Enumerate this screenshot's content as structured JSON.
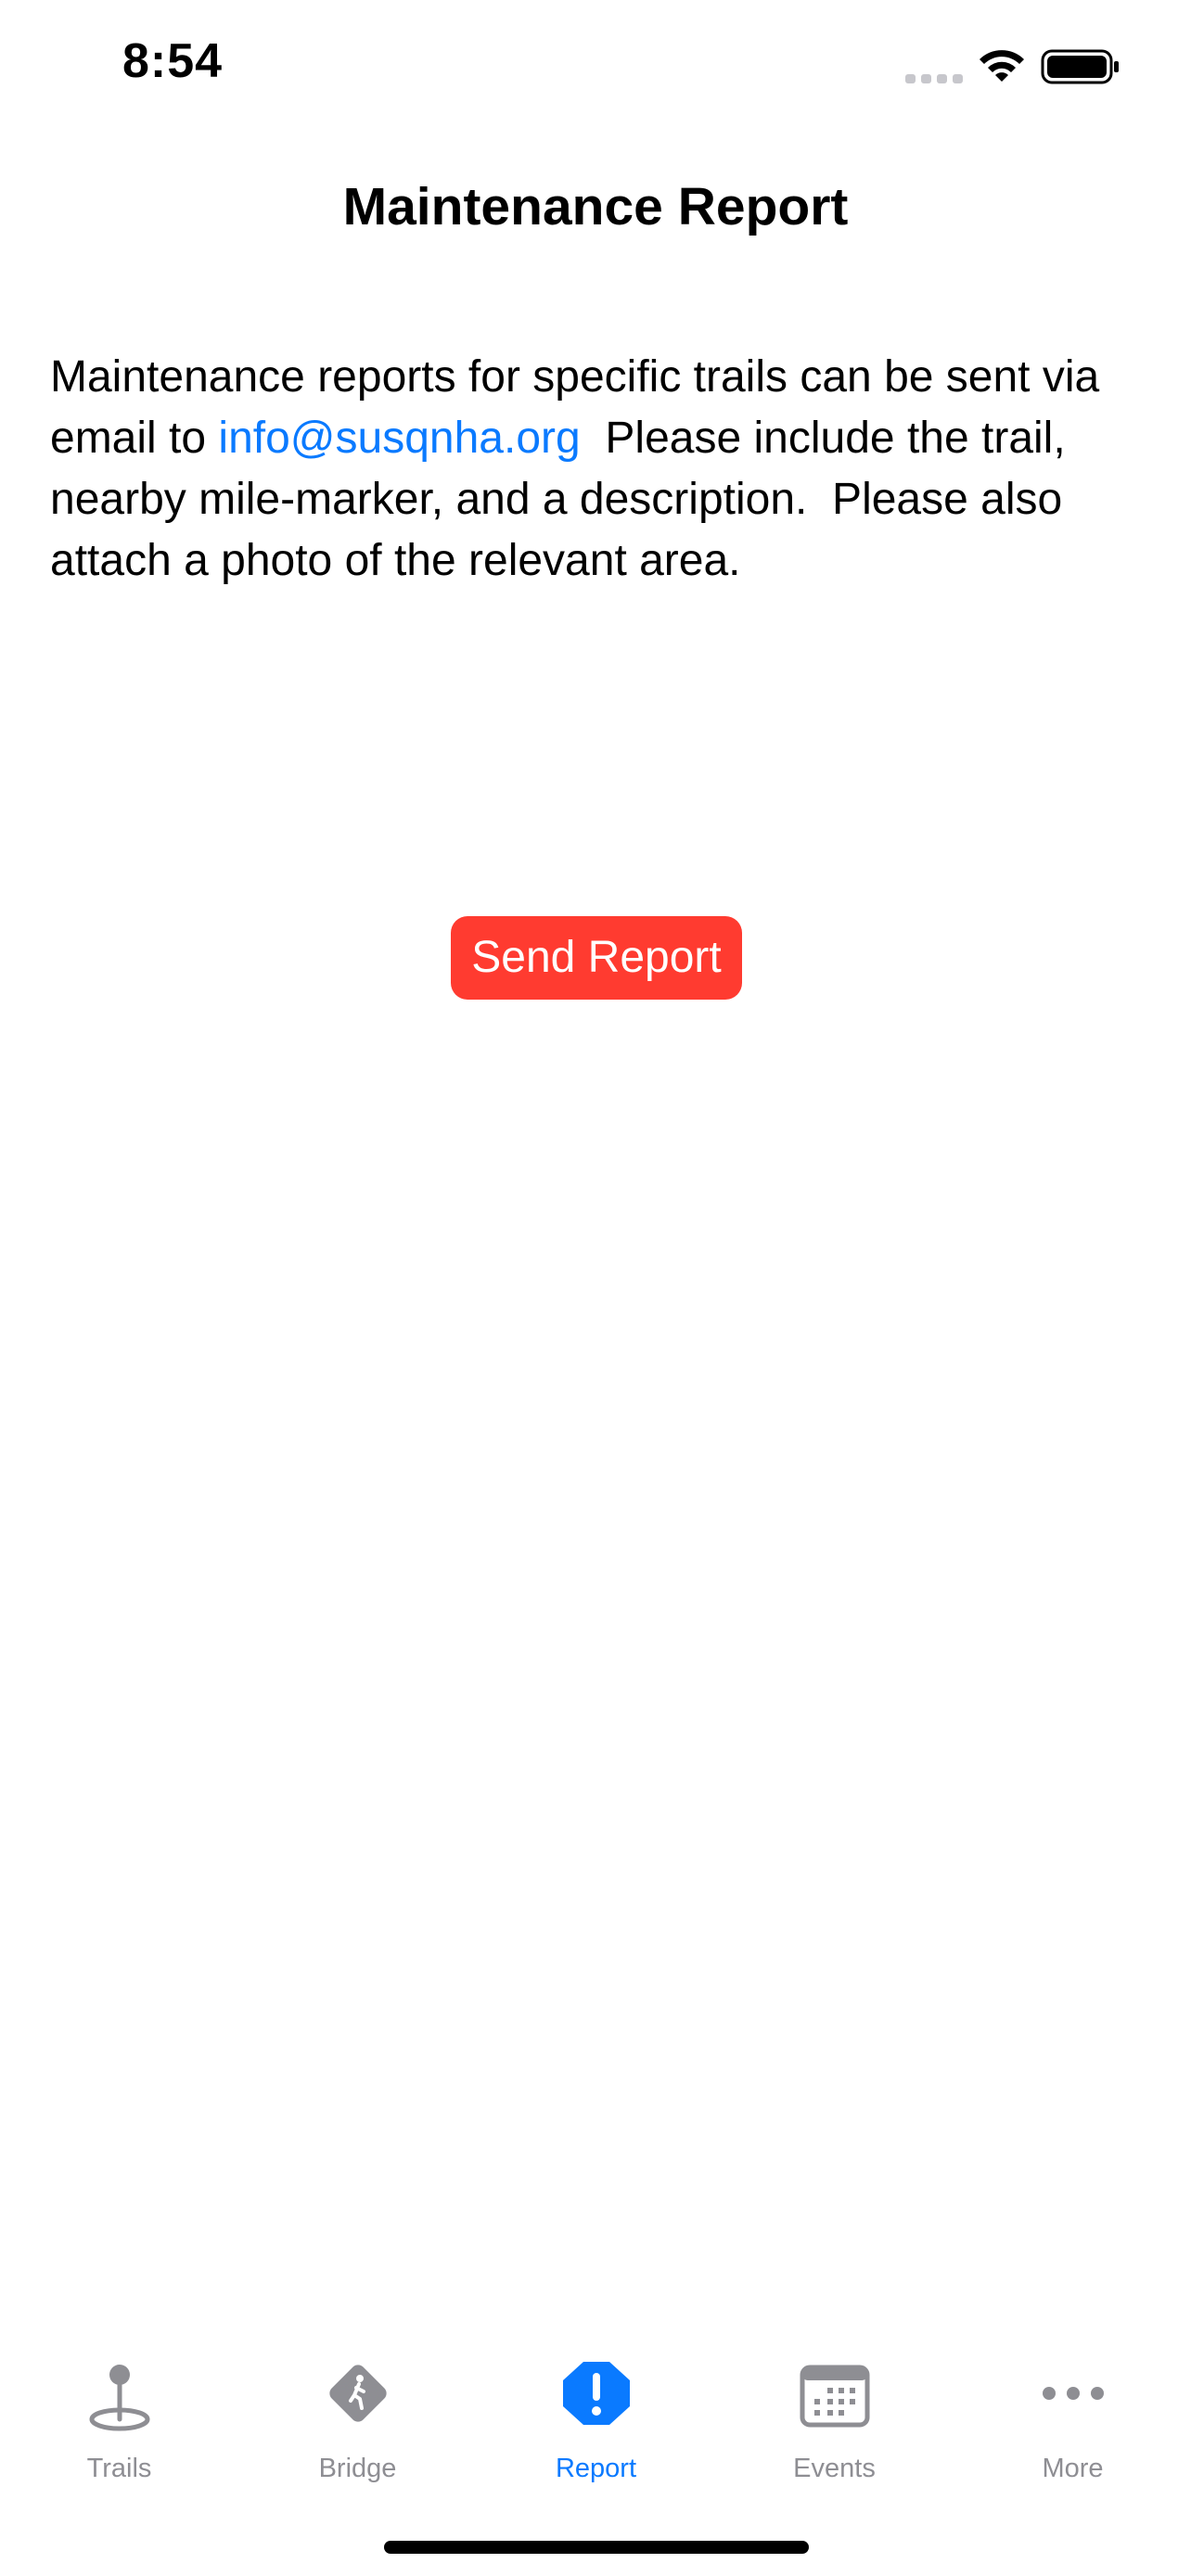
{
  "status_bar": {
    "time": "8:54"
  },
  "header": {
    "title": "Maintenance Report"
  },
  "content": {
    "text_before_link": "Maintenance reports for specific trails can be sent via email to ",
    "email_link": "info@susqnha.org",
    "text_after_link": "  Please include the trail, nearby mile-marker, and a description.  Please also attach a photo of the relevant area."
  },
  "actions": {
    "send_report_label": "Send Report"
  },
  "tab_bar": {
    "items": [
      {
        "label": "Trails",
        "icon": "map-pin-icon"
      },
      {
        "label": "Bridge",
        "icon": "pedestrian-sign-icon"
      },
      {
        "label": "Report",
        "icon": "exclamation-octagon-icon"
      },
      {
        "label": "Events",
        "icon": "calendar-icon"
      },
      {
        "label": "More",
        "icon": "ellipsis-icon"
      }
    ],
    "active_index": 2
  },
  "colors": {
    "accent": "#0a7aff",
    "button": "#ff3b30",
    "inactive": "#8e8e93"
  }
}
